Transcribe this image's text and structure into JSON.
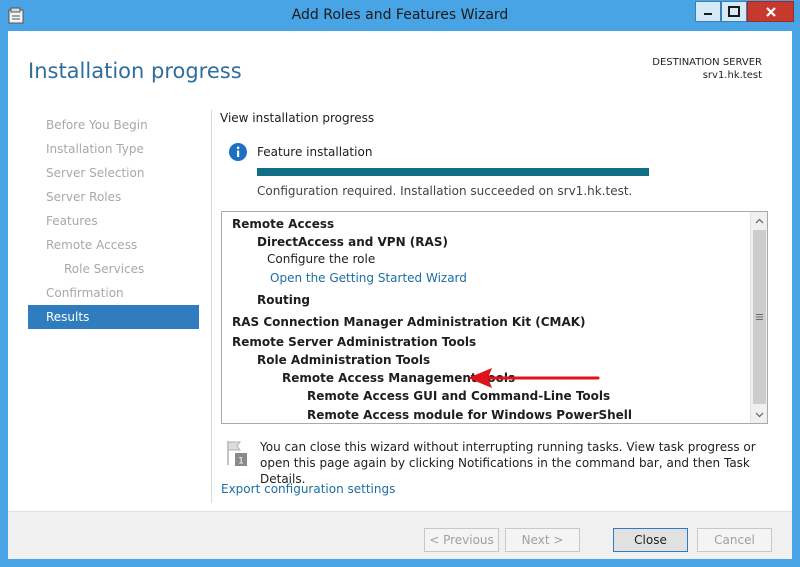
{
  "window": {
    "title": "Add Roles and Features Wizard"
  },
  "header": {
    "page_title": "Installation progress",
    "destination_label": "DESTINATION SERVER",
    "destination_server": "srv1.hk.test"
  },
  "nav": {
    "items": [
      {
        "label": "Before You Begin"
      },
      {
        "label": "Installation Type"
      },
      {
        "label": "Server Selection"
      },
      {
        "label": "Server Roles"
      },
      {
        "label": "Features"
      },
      {
        "label": "Remote Access"
      },
      {
        "label": "Role Services"
      },
      {
        "label": "Confirmation"
      },
      {
        "label": "Results"
      }
    ]
  },
  "main": {
    "view_label": "View installation progress",
    "feature_label": "Feature installation",
    "progress_percent": 100,
    "status": "Configuration required. Installation succeeded on srv1.hk.test.",
    "results": [
      {
        "text": "Remote Access"
      },
      {
        "text": "DirectAccess and VPN (RAS)"
      },
      {
        "text": "Configure the role"
      },
      {
        "text": "Open the Getting Started Wizard"
      },
      {
        "text": "Routing"
      },
      {
        "text": "RAS Connection Manager Administration Kit (CMAK)"
      },
      {
        "text": "Remote Server Administration Tools"
      },
      {
        "text": "Role Administration Tools"
      },
      {
        "text": "Remote Access Management Tools"
      },
      {
        "text": "Remote Access GUI and Command-Line Tools"
      },
      {
        "text": "Remote Access module for Windows PowerShell"
      }
    ],
    "notification": "You can close this wizard without interrupting running tasks. View task progress or open this page again by clicking Notifications in the command bar, and then Task Details.",
    "notification_badge": "1",
    "export_link": "Export configuration settings"
  },
  "footer": {
    "previous": "< Previous",
    "next": "Next >",
    "close": "Close",
    "cancel": "Cancel"
  },
  "colors": {
    "accent": "#2f7cbf",
    "link": "#1c6ea4",
    "progress": "#0f6e86",
    "arrow": "#e0121b"
  }
}
